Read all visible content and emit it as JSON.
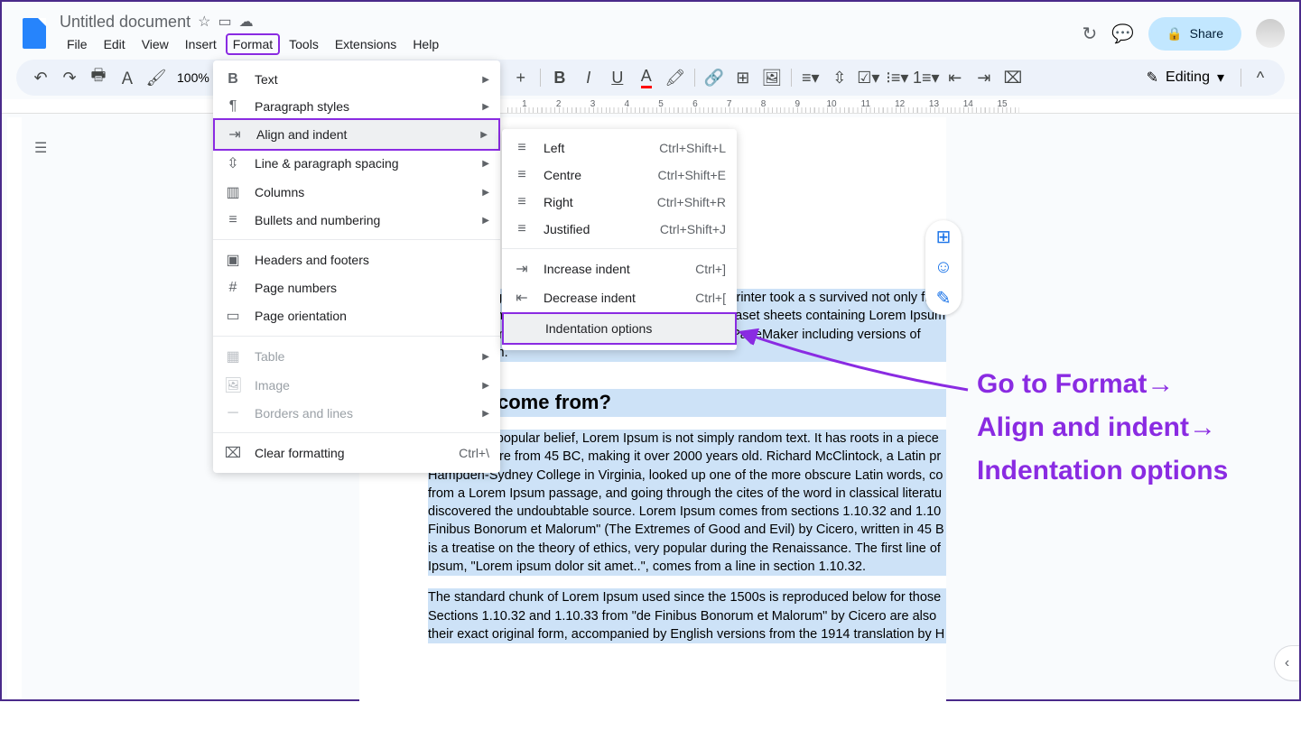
{
  "doc_title": "Untitled document",
  "menubar": {
    "file": "File",
    "edit": "Edit",
    "view": "View",
    "insert": "Insert",
    "format": "Format",
    "tools": "Tools",
    "extensions": "Extensions",
    "help": "Help"
  },
  "share_label": "Share",
  "zoom_value": "100%",
  "editing_label": "Editing",
  "format_menu": {
    "text": "Text",
    "paragraph": "Paragraph styles",
    "align": "Align and indent",
    "spacing": "Line & paragraph spacing",
    "columns": "Columns",
    "bullets": "Bullets and numbering",
    "headers": "Headers and footers",
    "pagenum": "Page numbers",
    "orient": "Page orientation",
    "table": "Table",
    "image": "Image",
    "borders": "Borders and lines",
    "clear": "Clear formatting",
    "clear_shortcut": "Ctrl+\\"
  },
  "submenu": {
    "left": {
      "label": "Left",
      "shortcut": "Ctrl+Shift+L"
    },
    "centre": {
      "label": "Centre",
      "shortcut": "Ctrl+Shift+E"
    },
    "right": {
      "label": "Right",
      "shortcut": "Ctrl+Shift+R"
    },
    "justified": {
      "label": "Justified",
      "shortcut": "Ctrl+Shift+J"
    },
    "increase": {
      "label": "Increase indent",
      "shortcut": "Ctrl+]"
    },
    "decrease": {
      "label": "Decrease indent",
      "shortcut": "Ctrl+["
    },
    "indentopt": "Indentation options"
  },
  "ruler": [
    "1",
    "2",
    "3",
    "4",
    "5",
    "6",
    "7",
    "8",
    "9",
    "10",
    "11",
    "12",
    "13",
    "14",
    "15"
  ],
  "doc": {
    "p1": "d typesetting industry. Lorem Ips\n when an unknown printer took a\ns survived not only five centuries, \nunchanged. It was popularised in th\nof Letraset sheets containing Lorem Ipsum passages, and more recently wit\nsoftware like Aldus PageMaker including versions of Lorem Ipsum.",
    "h1": "does it come from?",
    "p2": "Contrary to popular belief, Lorem Ipsum is not simply random text. It has roots in a piece Latin literature from 45 BC, making it over 2000 years old. Richard McClintock, a Latin pr Hampden-Sydney College in Virginia, looked up one of the more obscure Latin words, co from a Lorem Ipsum passage, and going through the cites of the word in classical literatu discovered the undoubtable source. Lorem Ipsum comes from sections 1.10.32 and 1.10 Finibus Bonorum et Malorum\" (The Extremes of Good and Evil) by Cicero, written in 45 B is a treatise on the theory of ethics, very popular during the Renaissance. The first line of Ipsum, \"Lorem ipsum dolor sit amet..\", comes from a line in section 1.10.32.",
    "p3": "The standard chunk of Lorem Ipsum used since the 1500s is reproduced below for those Sections 1.10.32 and 1.10.33 from \"de Finibus Bonorum et Malorum\" by Cicero are also their exact original form, accompanied by English versions from the 1914 translation by H"
  },
  "annotation": {
    "l1": "Go to Format→",
    "l2": "Align and indent→",
    "l3": "Indentation options"
  }
}
